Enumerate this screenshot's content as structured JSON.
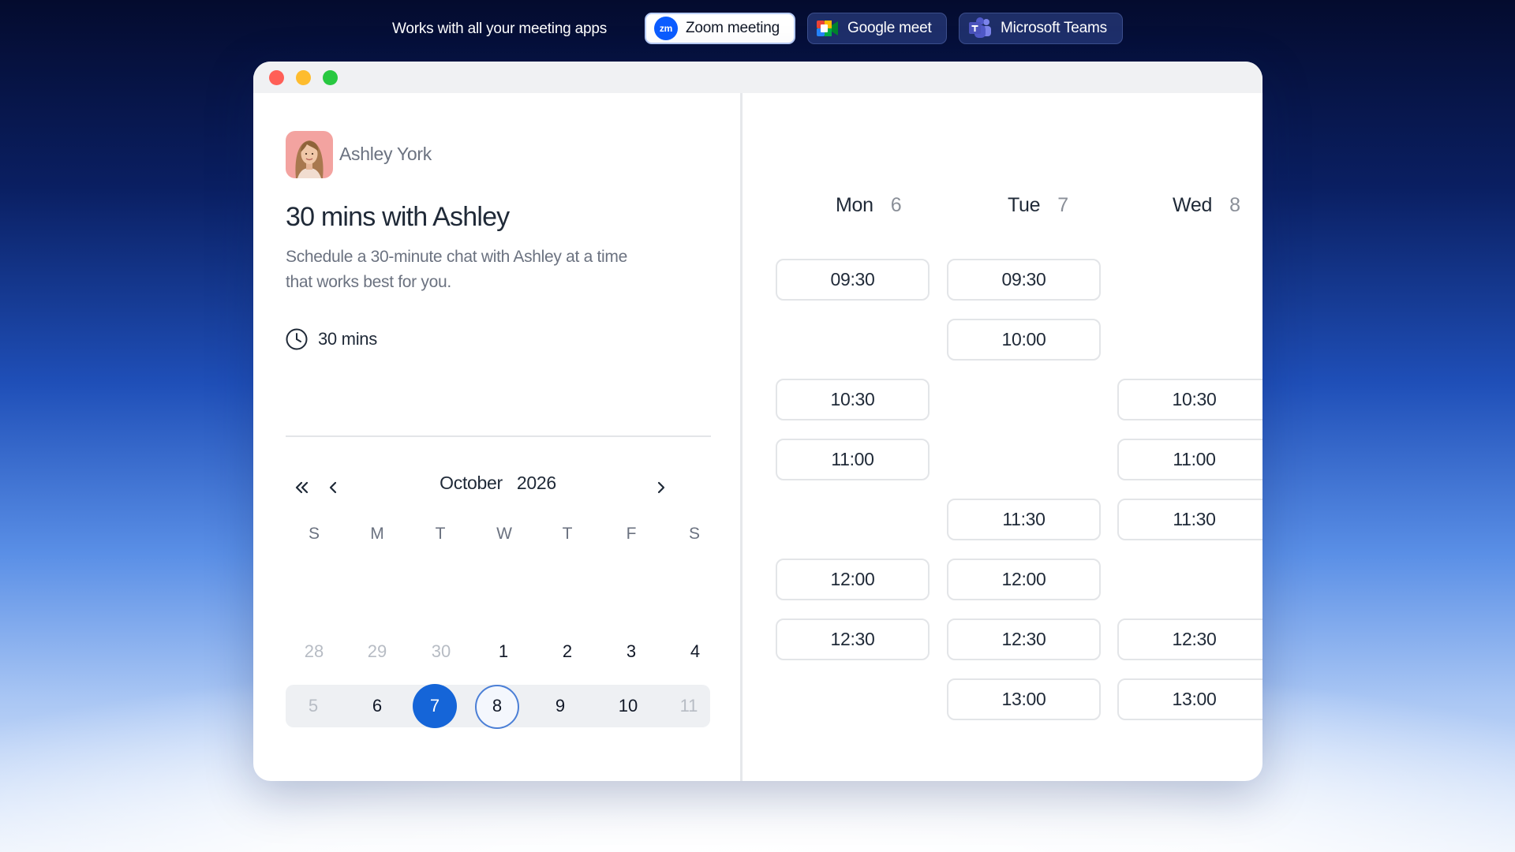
{
  "banner": {
    "tagline": "Works with all your meeting apps",
    "apps": [
      {
        "label": "Zoom meeting",
        "logo_text": "zm",
        "active": true
      },
      {
        "label": "Google meet",
        "active": false
      },
      {
        "label": "Microsoft Teams",
        "active": false
      }
    ]
  },
  "host": {
    "name": "Ashley York"
  },
  "event": {
    "title": "30 mins with Ashley",
    "description": "Schedule a 30-minute chat with Ashley at a time that works best for you.",
    "duration": "30 mins"
  },
  "calendar": {
    "month": "October",
    "year": "2026",
    "weekdays": [
      "S",
      "M",
      "T",
      "W",
      "T",
      "F",
      "S"
    ],
    "rows": [
      [
        "28",
        "29",
        "30",
        "1",
        "2",
        "3",
        "4"
      ],
      [
        "5",
        "6",
        "7",
        "8",
        "9",
        "10",
        "11"
      ]
    ],
    "selected_day": "7",
    "today_day": "8"
  },
  "schedule": {
    "columns": [
      {
        "day": "Mon",
        "date": "6",
        "slots": [
          "09:30",
          "10:30",
          "11:00",
          "12:00",
          "12:30"
        ]
      },
      {
        "day": "Tue",
        "date": "7",
        "slots": [
          "09:30",
          "10:00",
          "11:30",
          "12:00",
          "12:30",
          "13:00"
        ]
      },
      {
        "day": "Wed",
        "date": "8",
        "slots": [
          "10:30",
          "11:00",
          "11:30",
          "12:30",
          "13:00"
        ]
      }
    ]
  },
  "colors": {
    "accent": "#1565d8",
    "zoom_brand": "#0b5cff",
    "traffic_red": "#ff5f57",
    "traffic_yellow": "#febc2e",
    "traffic_green": "#28c840"
  },
  "icons": [
    "zoom-logo-icon",
    "google-meet-logo-icon",
    "microsoft-teams-logo-icon",
    "clock-icon",
    "double-chevron-left-icon",
    "chevron-left-icon",
    "chevron-right-icon"
  ]
}
